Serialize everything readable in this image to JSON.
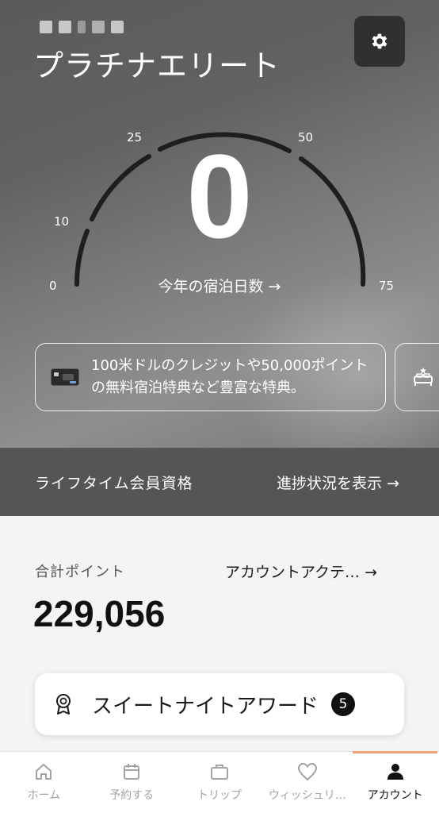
{
  "header": {
    "tier_title": "プラチナエリート"
  },
  "gauge": {
    "nights_value": "0",
    "nights_label": "今年の宿泊日数 →",
    "ticks": [
      "0",
      "10",
      "25",
      "50",
      "75"
    ],
    "max": 75,
    "current": 0
  },
  "benefits": [
    {
      "text": "100米ドルのクレジットや50,000ポイントの無料宿泊特典など豊富な特典。",
      "icon": "credit-card-icon"
    },
    {
      "text": "",
      "icon": "bed-star-icon"
    }
  ],
  "lifetime": {
    "label": "ライフタイム会員資格",
    "progress_link": "進捗状況を表示 →"
  },
  "points": {
    "label": "合計ポイント",
    "activity_link": "アカウントアクテ… →",
    "value": "229,056"
  },
  "award": {
    "label": "スイートナイトアワード",
    "count": "5"
  },
  "tabs": [
    {
      "label": "ホーム",
      "icon": "home-icon",
      "active": false
    },
    {
      "label": "予約する",
      "icon": "calendar-icon",
      "active": false
    },
    {
      "label": "トリップ",
      "icon": "briefcase-icon",
      "active": false
    },
    {
      "label": "ウィッシュリ…",
      "icon": "heart-icon",
      "active": false
    },
    {
      "label": "アカウント",
      "icon": "person-icon",
      "active": true
    }
  ],
  "colors": {
    "accent_tab_indicator": "#f0a27a",
    "gauge_track": "#1e1e1f"
  }
}
